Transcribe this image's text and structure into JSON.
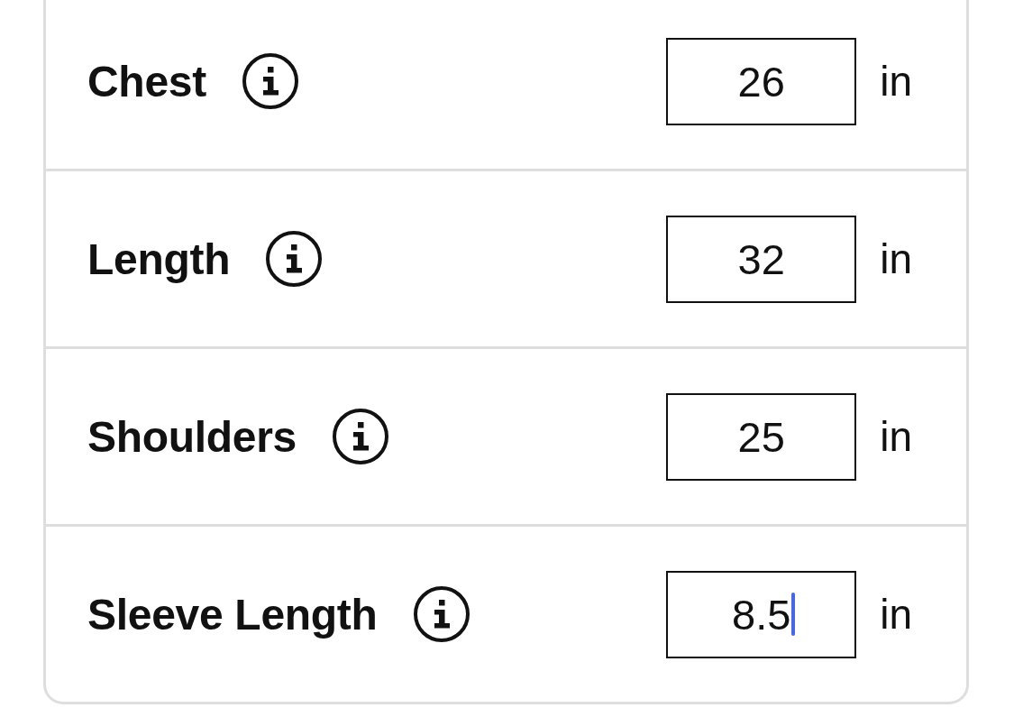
{
  "measurements": [
    {
      "label": "Chest",
      "value": "26",
      "unit": "in",
      "focused": false
    },
    {
      "label": "Length",
      "value": "32",
      "unit": "in",
      "focused": false
    },
    {
      "label": "Shoulders",
      "value": "25",
      "unit": "in",
      "focused": false
    },
    {
      "label": "Sleeve Length",
      "value": "8.5",
      "unit": "in",
      "focused": true
    }
  ]
}
